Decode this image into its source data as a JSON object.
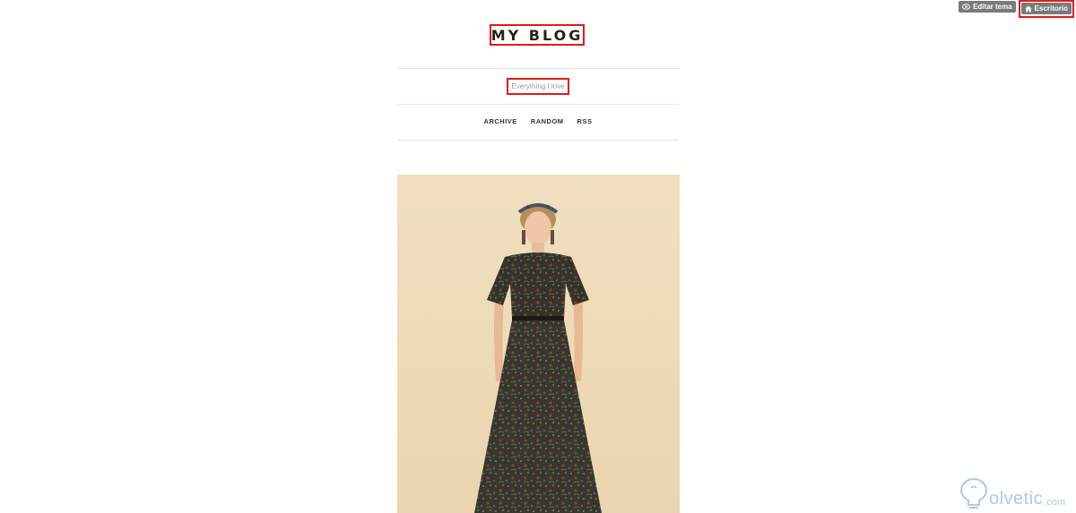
{
  "toolbar": {
    "edit_theme_label": "Editar tema",
    "edit_theme_icon": "eye-icon",
    "dashboard_label": "Escritorio",
    "dashboard_icon": "home-icon"
  },
  "blog": {
    "title": "MY BLOG",
    "description": "Everything I love"
  },
  "nav": {
    "items": [
      {
        "label": "ARCHIVE"
      },
      {
        "label": "RANDOM"
      },
      {
        "label": "RSS"
      }
    ]
  },
  "post": {
    "image_subject": "fashion-photo"
  },
  "watermark": {
    "logo_text": "olvetic",
    "logo_suffix": ".com"
  },
  "colors": {
    "highlight_box": "#e21a1a",
    "toolbar_bg": "#7a7a7a",
    "image_bg": "#efdcbb",
    "watermark": "#a9cbe6"
  }
}
